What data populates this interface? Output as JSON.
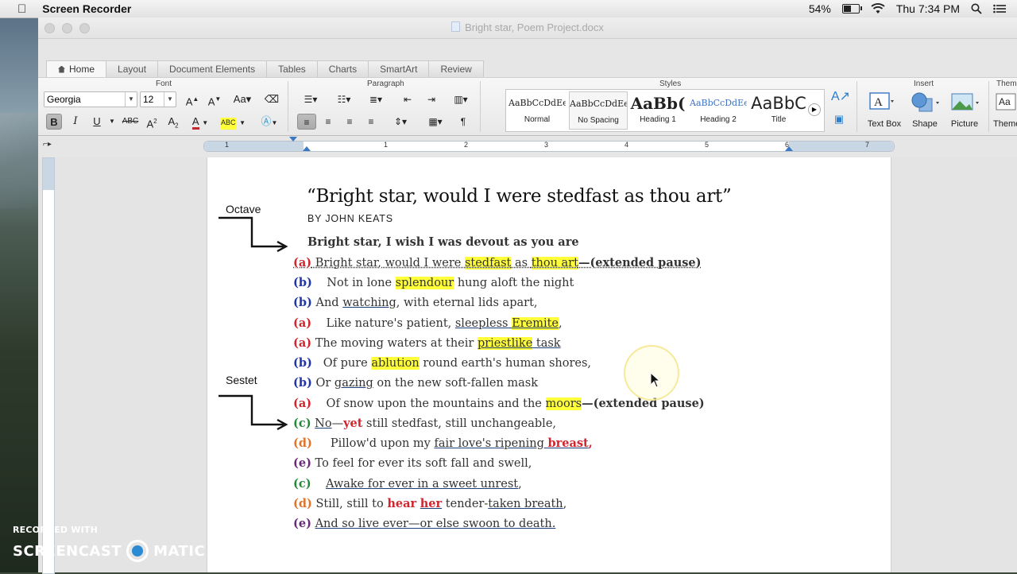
{
  "menubar": {
    "app_name": "Screen Recorder",
    "battery": "54%",
    "clock": "Thu 7:34 PM"
  },
  "window": {
    "document_title": "Bright star, Poem Project.docx"
  },
  "tabs": [
    "Home",
    "Layout",
    "Document Elements",
    "Tables",
    "Charts",
    "SmartArt",
    "Review"
  ],
  "ribbon": {
    "font_group": "Font",
    "paragraph_group": "Paragraph",
    "styles_group": "Styles",
    "insert_group": "Insert",
    "themes_group": "Theme",
    "font_name": "Georgia",
    "font_size": "12",
    "styles": [
      {
        "sample": "AaBbCcDdEe",
        "name": "Normal"
      },
      {
        "sample": "AaBbCcDdEe",
        "name": "No Spacing"
      },
      {
        "sample": "AaBb(",
        "name": "Heading 1"
      },
      {
        "sample": "AaBbCcDdEe",
        "name": "Heading 2"
      },
      {
        "sample": "AaBbC",
        "name": "Title"
      }
    ],
    "insert": [
      "Text Box",
      "Shape",
      "Picture"
    ],
    "themes_label": "Themes"
  },
  "ruler": {
    "numbers": [
      "1",
      "1",
      "2",
      "3",
      "4",
      "5",
      "6",
      "7"
    ]
  },
  "document": {
    "title": "“Bright star, would I were stedfast as thou art”",
    "author": "BY JOHN KEATS",
    "subheading": "Bright star, I wish I was devout as you are",
    "annotations": {
      "octave": "Octave",
      "sestet": "Sestet"
    },
    "lines": {
      "l1": {
        "tag": "(a)",
        "t1": "Bright star, would I were ",
        "h1": "stedfast",
        "t2": " as ",
        "h2": "thou art",
        "t3": "—(extended pause)"
      },
      "l2": {
        "tag": "(b)",
        "t1": "    Not in lone ",
        "h1": "splendour",
        "t2": " hung aloft the night"
      },
      "l3": {
        "tag": "(b)",
        "t1": " And ",
        "u1": "watching",
        "t2": ", with eternal lids apart,"
      },
      "l4": {
        "tag": "(a)",
        "t1": "    Like nature's patient, ",
        "u1": "sleepless ",
        "h1": "Eremite",
        "t2": ","
      },
      "l5": {
        "tag": "(a)",
        "t1": " The moving waters at their ",
        "h1": "priestlike",
        "u1": " task"
      },
      "l6": {
        "tag": "(b)",
        "t1": "   Of pure ",
        "h1": "ablution",
        "t2": " round earth's human shores,"
      },
      "l7": {
        "tag": "(b)",
        "t1": " Or ",
        "u1": "gazing",
        "t2": " on the new soft-fallen mask"
      },
      "l8": {
        "tag": "(a)",
        "t1": "    Of snow upon the mountains and the ",
        "h1": "moors",
        "t2": "—(extended pause)"
      },
      "l9": {
        "tag": "(c)",
        "u1": "No",
        "t1": "—",
        "r1": "yet",
        "t2": " still stedfast, still unchangeable,"
      },
      "l10": {
        "tag": "(d)",
        "t1": "     Pillow'd upon my ",
        "u1": "fair love's ripening",
        "t2": " ",
        "r1": "breast",
        "t3": ","
      },
      "l11": {
        "tag": "(e)",
        "t1": " To feel for ever its soft fall and swell,"
      },
      "l12": {
        "tag": "(c)",
        "t1": "    ",
        "u1": "Awake for ever in a sweet unrest",
        "t2": ","
      },
      "l13": {
        "tag": "(d)",
        "t1": " Still, still to ",
        "r1": "hear",
        "t2": " ",
        "r2": "her",
        "t3": " tender-",
        "u1": "taken breath",
        "t4": ","
      },
      "l14": {
        "tag": "(e)",
        "t1": " ",
        "u1": "And so live ever—or else swoon to death."
      }
    }
  },
  "watermark": {
    "recorded_with": "RECORDED WITH",
    "brand_left": "SCREENCAST",
    "brand_right": "MATIC"
  }
}
